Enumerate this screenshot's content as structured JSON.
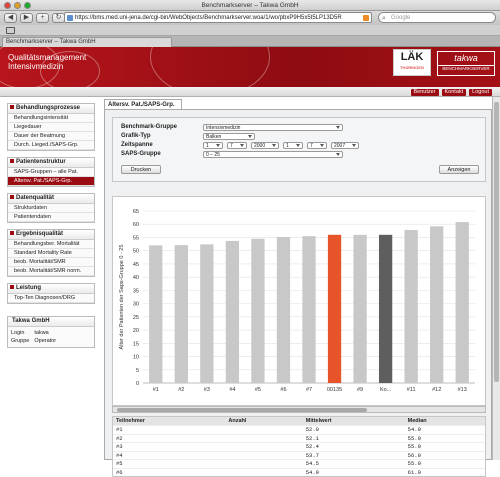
{
  "window": {
    "title": "Benchmarkserver – Takwa GmbH"
  },
  "browser": {
    "url": "https://bms.med.uni-jena.de/cgi-bin/WebObjects/Benchmarkserver.woa/1/wo/pbxP9H5x5t5LP13D5R",
    "search_placeholder": "Google",
    "tab_label": "Benchmarkserver – Takwa GmbH",
    "back": "◀",
    "forward": "▶",
    "add": "+",
    "reload": "↻"
  },
  "header": {
    "line1": "Qualitätsmanagement",
    "line2": "Intensivmedizin",
    "lak_logo": "LÄK",
    "lak_sub": "THÜRINGEN",
    "takwa_logo": "takwa",
    "takwa_sub": "BENCHMARKSERVER"
  },
  "topnav": [
    "Benutzer",
    "Kontakt",
    "Logout"
  ],
  "sidebar": [
    {
      "title": "Behandlungsprozesse",
      "items": [
        "Behandlungsintensität",
        "Liegedauer",
        "Dauer der Beatmung",
        "Durch. Lieged./SAPS-Grp."
      ]
    },
    {
      "title": "Patientenstruktur",
      "items": [
        "SAPS-Gruppen – alle Pat.",
        "Altersv. Pat./SAPS-Grp."
      ],
      "selected": 1
    },
    {
      "title": "Datenqualität",
      "items": [
        "Strukturdaten",
        "Patientendaten"
      ]
    },
    {
      "title": "Ergebnisqualität",
      "items": [
        "Behandlungsber. Mortalität",
        "Standard Mortality Rate",
        "beob. Mortalität/SMR",
        "beob. Mortalität/SMR norm."
      ]
    },
    {
      "title": "Leistung",
      "items": [
        "Top-Ten Diagnosen/DRG"
      ]
    }
  ],
  "info": {
    "title": "Takwa GmbH",
    "rows": [
      [
        "Login",
        "takwa"
      ],
      [
        "Gruppe",
        "Operator"
      ]
    ]
  },
  "main": {
    "tab": "Altersv. Pat./SAPS-Grp.",
    "form": {
      "benchmark_label": "Benchmark-Gruppe",
      "benchmark_value": "Intensivmedizin",
      "grafik_label": "Grafik-Typ",
      "grafik_value": "Balken",
      "zeitspanne_label": "Zeitspanne",
      "from": [
        "1",
        "7",
        "2000",
        "1",
        "7",
        "2007"
      ],
      "saps_label": "SAPS-Gruppe",
      "saps_value": "0 – 25",
      "print_label": "Drucken",
      "show_label": "Anzeigen"
    }
  },
  "chart_data": {
    "type": "bar",
    "ylabel": "Alter der Patienten der Saps-Gruppe 0 - 25",
    "ylim": [
      0,
      65
    ],
    "yticks": [
      0,
      5,
      10,
      15,
      20,
      25,
      30,
      35,
      40,
      45,
      50,
      55,
      60,
      65
    ],
    "grid": true,
    "categories": [
      "#1",
      "#2",
      "#3",
      "#4",
      "#5",
      "#6",
      "#7",
      "00135",
      "#9",
      "Ko...",
      "#11",
      "#12",
      "#13"
    ],
    "values": [
      52.0,
      52.1,
      52.4,
      53.7,
      54.5,
      55.2,
      55.5,
      56.0,
      56.0,
      56.0,
      57.8,
      59.2,
      60.8
    ],
    "colors": [
      "#c8c8c8",
      "#c8c8c8",
      "#c8c8c8",
      "#c8c8c8",
      "#c8c8c8",
      "#c8c8c8",
      "#c8c8c8",
      "#e8542a",
      "#c8c8c8",
      "#5e5e5e",
      "#c8c8c8",
      "#c8c8c8",
      "#c8c8c8"
    ]
  },
  "table": {
    "headers": [
      "Teilnehmer",
      "Anzahl",
      "Mittelwert",
      "Median"
    ],
    "rows": [
      [
        "#1",
        "",
        "52.0",
        "54.0"
      ],
      [
        "#2",
        "",
        "52.1",
        "55.0"
      ],
      [
        "#3",
        "",
        "52.4",
        "55.0"
      ],
      [
        "#4",
        "",
        "53.7",
        "56.0"
      ],
      [
        "#5",
        "",
        "54.5",
        "55.0"
      ],
      [
        "#6",
        "",
        "54.9",
        "61.0"
      ]
    ]
  }
}
